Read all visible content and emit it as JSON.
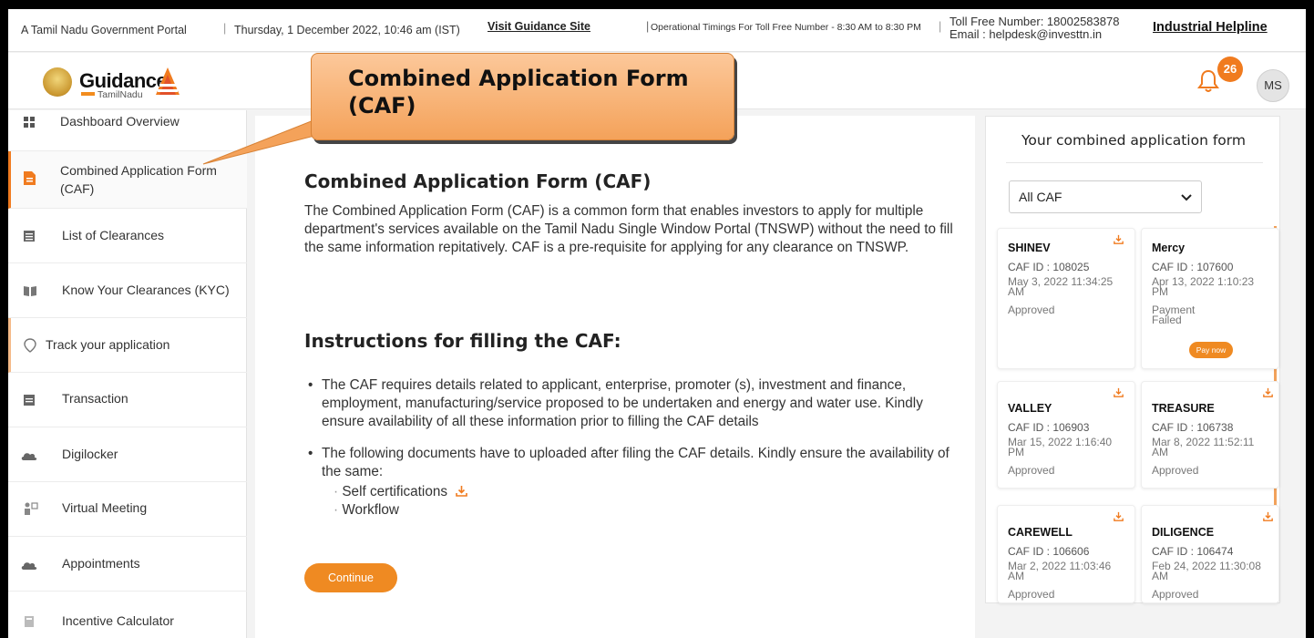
{
  "topbar": {
    "portal": "A Tamil Nadu Government Portal",
    "separator": "|",
    "datetime": "Thursday, 1 December 2022, 10:46 am (IST)",
    "visit_link": "Visit Guidance Site",
    "timings": "Operational Timings For Toll Free Number - 8:30 AM to 8:30 PM",
    "toll_free": "Toll Free Number: 18002583878",
    "email": "Email : helpdesk@investtn.in",
    "industrial_helpline": "Industrial Helpline"
  },
  "header": {
    "logo_text": "Guidance",
    "logo_sub": "TamilNadu",
    "notification_count": "26",
    "avatar_initials": "MS",
    "accent": "#f07b1f"
  },
  "callout": {
    "text": "Combined Application Form (CAF)"
  },
  "sidebar": {
    "items": [
      {
        "label": "Dashboard Overview",
        "icon": "grid-icon"
      },
      {
        "label": "Combined Application Form (CAF)",
        "icon": "document-icon",
        "active": true
      },
      {
        "label": "List of Clearances",
        "icon": "list-icon"
      },
      {
        "label": "Know Your Clearances (KYC)",
        "icon": "book-icon"
      },
      {
        "label": "Track your application",
        "icon": "location-icon"
      },
      {
        "label": "Transaction",
        "icon": "transaction-icon"
      },
      {
        "label": "Digilocker",
        "icon": "cloud-icon"
      },
      {
        "label": "Virtual Meeting",
        "icon": "meeting-icon"
      },
      {
        "label": "Appointments",
        "icon": "cloud-icon"
      },
      {
        "label": "Incentive Calculator",
        "icon": "calculator-icon"
      }
    ]
  },
  "main": {
    "title": "Combined Application Form (CAF)",
    "description": "The Combined Application Form (CAF) is a common form that enables investors to apply for multiple department's services available on the Tamil Nadu Single Window Portal (TNSWP) without the need to fill the same information repitatively. CAF is a pre-requisite for applying for any clearance on TNSWP.",
    "instructions_title": "Instructions for filling the CAF:",
    "bullets": [
      "The CAF requires details related to applicant, enterprise, promoter (s), investment and finance, employment, manufacturing/service proposed to be undertaken and energy and water use. Kindly ensure availability of all these information prior to filling the CAF details",
      "The following documents have to uploaded after filing the CAF details. Kindly ensure the availability of the same:"
    ],
    "sub_items": [
      "Self certifications",
      "Workflow"
    ],
    "continue_label": "Continue"
  },
  "right_panel": {
    "title": "Your combined application form",
    "select_value": "All CAF",
    "cards": [
      {
        "name": "SHINEV",
        "caf_id": "CAF ID : 108025",
        "date": "May 3, 2022 11:34:25 AM",
        "status": "Approved"
      },
      {
        "name": "Mercy",
        "caf_id": "CAF ID : 107600",
        "date": "Apr 13, 2022 1:10:23 PM",
        "status": "Payment Failed",
        "action": "Pay now"
      },
      {
        "name": "VALLEY",
        "caf_id": "CAF ID : 106903",
        "date": "Mar 15, 2022 1:16:40 PM",
        "status": "Approved"
      },
      {
        "name": "TREASURE",
        "caf_id": "CAF ID : 106738",
        "date": "Mar 8, 2022 11:52:11 AM",
        "status": "Approved"
      },
      {
        "name": "CAREWELL",
        "caf_id": "CAF ID : 106606",
        "date": "Mar 2, 2022 11:03:46 AM",
        "status": "Approved"
      },
      {
        "name": "DILIGENCE",
        "caf_id": "CAF ID : 106474",
        "date": "Feb 24, 2022 11:30:08 AM",
        "status": "Approved"
      }
    ]
  }
}
